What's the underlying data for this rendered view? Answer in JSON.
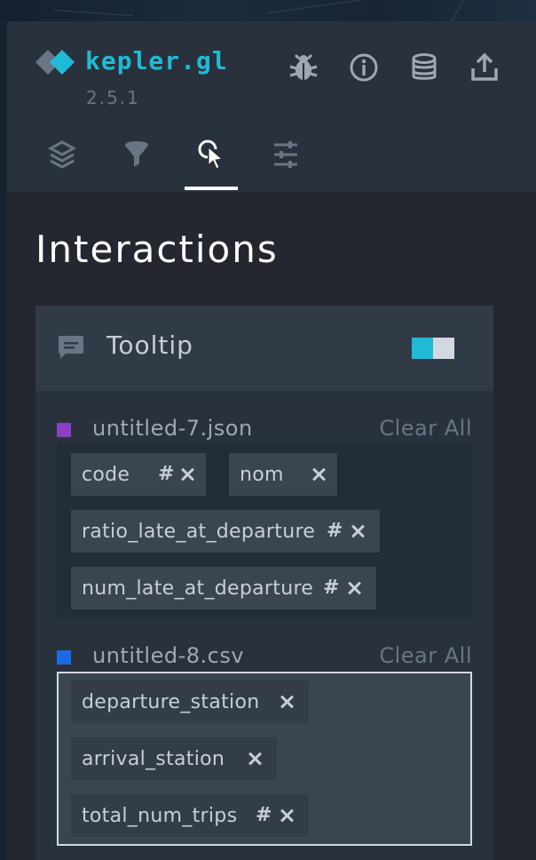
{
  "app": {
    "name": "kepler.gl",
    "version": "2.5.1"
  },
  "header_actions": [
    {
      "icon": "bug-icon"
    },
    {
      "icon": "info-icon"
    },
    {
      "icon": "database-icon"
    },
    {
      "icon": "share-icon"
    }
  ],
  "nav_tabs": [
    {
      "icon": "layers-icon",
      "active": false
    },
    {
      "icon": "filter-icon",
      "active": false
    },
    {
      "icon": "interactions-cursor-icon",
      "active": true
    },
    {
      "icon": "sliders-icon",
      "active": false
    }
  ],
  "page_title": "Interactions",
  "tooltip": {
    "label": "Tooltip",
    "enabled": true,
    "colors": {
      "accent": "#1fbad6"
    },
    "datasets": [
      {
        "name": "untitled-7.json",
        "color": "#8b3fc4",
        "clear_label": "Clear All",
        "fields": [
          {
            "label": "code",
            "numeric": true
          },
          {
            "label": "nom",
            "numeric": false
          },
          {
            "label": "ratio_late_at_departure",
            "numeric": true
          },
          {
            "label": "num_late_at_departure",
            "numeric": true
          }
        ]
      },
      {
        "name": "untitled-8.csv",
        "color": "#1a6ae8",
        "clear_label": "Clear All",
        "fields": [
          {
            "label": "departure_station",
            "numeric": false
          },
          {
            "label": "arrival_station",
            "numeric": false
          },
          {
            "label": "total_num_trips",
            "numeric": true
          }
        ]
      }
    ],
    "hash_symbol": "#"
  }
}
